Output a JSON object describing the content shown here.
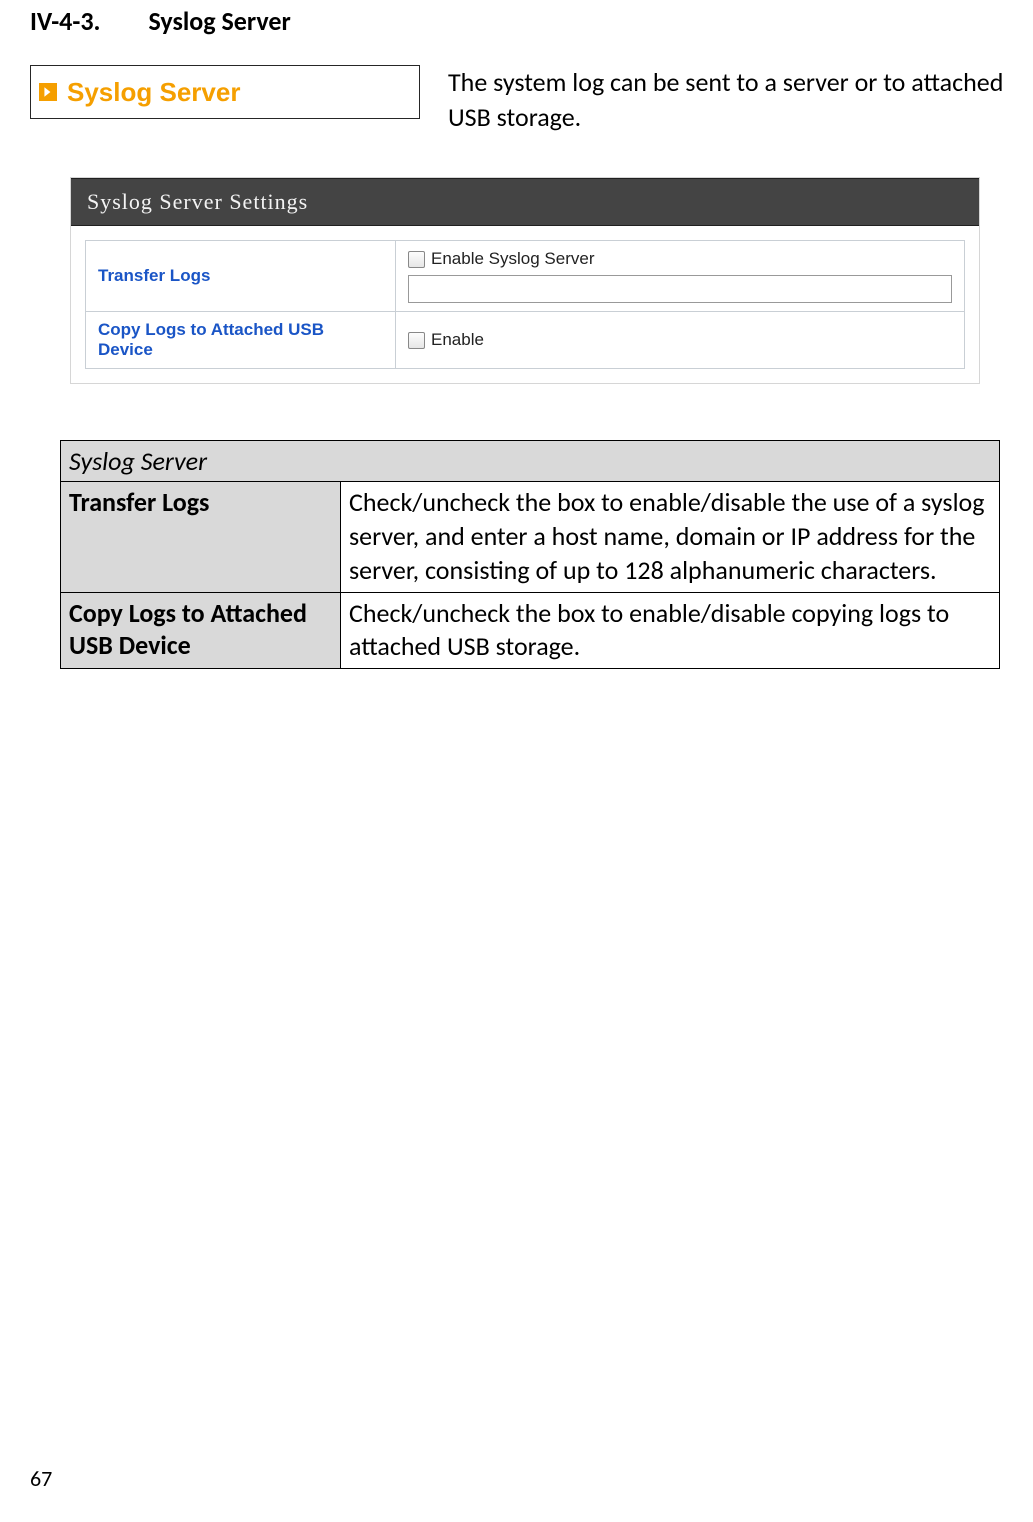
{
  "heading": {
    "number": "IV-4-3.",
    "title": "Syslog Server"
  },
  "badge": {
    "text": "Syslog Server"
  },
  "intro": "The system log can be sent to a server or to attached USB storage.",
  "settings_panel": {
    "title": "Syslog Server Settings",
    "rows": {
      "transfer_logs": {
        "label": "Transfer Logs",
        "checkbox_label": "Enable Syslog Server"
      },
      "copy_usb": {
        "label": "Copy Logs to Attached USB Device",
        "checkbox_label": "Enable"
      }
    }
  },
  "desc_table": {
    "caption": "Syslog Server",
    "rows": [
      {
        "label": "Transfer Logs",
        "value": "Check/uncheck the box to enable/disable the use of a syslog server, and enter a host name, domain or IP address for the server, consisting of up to 128 alphanumeric characters."
      },
      {
        "label": "Copy Logs to Attached USB Device",
        "value": "Check/uncheck the box to enable/disable copying logs to attached USB storage."
      }
    ]
  },
  "page_number": "67"
}
